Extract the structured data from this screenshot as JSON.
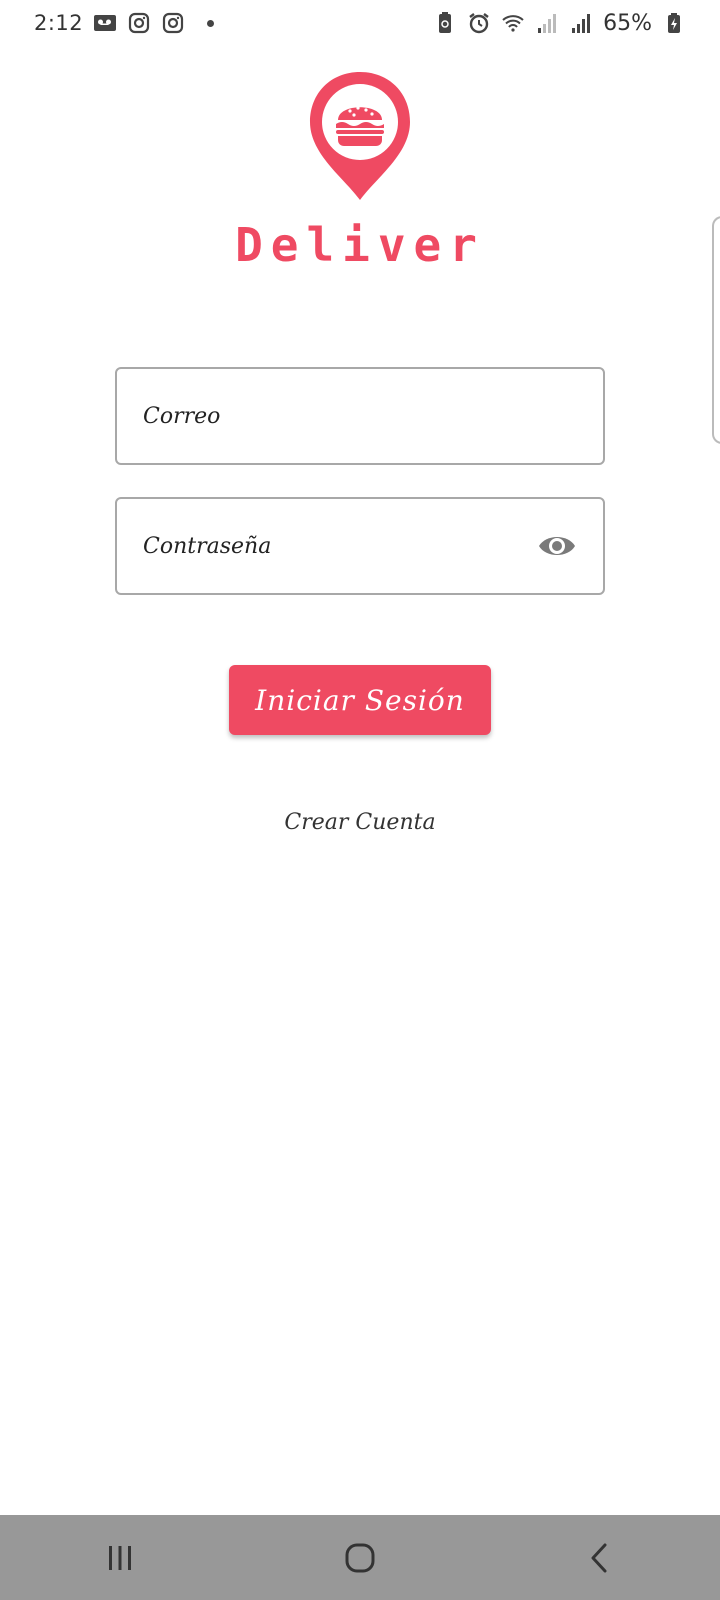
{
  "status_bar": {
    "time": "2:12",
    "battery_percent": "65%",
    "left_icons": [
      "voicemail-icon",
      "instagram-icon",
      "instagram-icon",
      "notification-dot"
    ],
    "right_icons": [
      "battery-saver-icon",
      "alarm-icon",
      "wifi-icon",
      "signal-icon",
      "signal-icon",
      "battery-charging-icon"
    ]
  },
  "brand": {
    "name": "Deliver",
    "logo_icon": "burger-location-pin-icon",
    "color": "#ef4a62"
  },
  "form": {
    "email_placeholder": "Correo",
    "password_placeholder": "Contraseña",
    "password_toggle_icon": "eye-icon",
    "login_label": "Iniciar Sesión",
    "create_account_label": "Crear Cuenta"
  },
  "nav_bar": {
    "buttons": [
      "recent-apps-icon",
      "home-icon",
      "back-icon"
    ]
  }
}
